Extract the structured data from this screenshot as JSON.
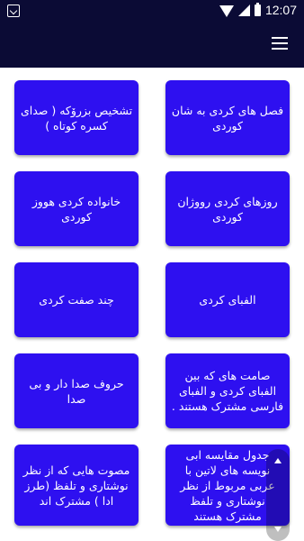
{
  "status_bar": {
    "time": "12:07",
    "icons": [
      "notification-icon",
      "wifi-icon",
      "signal-icon",
      "battery-icon"
    ]
  },
  "app_bar": {
    "menu_icon": "hamburger-menu-icon"
  },
  "colors": {
    "bar_background": "#0b0b35",
    "card_background": "#2e10f0",
    "card_text": "#ffffff"
  },
  "cards": [
    {
      "label": "فصل های کردی به شان کوردی"
    },
    {
      "label": "تشخیص بزرۆکه ( صدای کسره کوتاه )"
    },
    {
      "label": "روزهای کردی رووژان کوردی"
    },
    {
      "label": "خانواده کردی هووز کوردی"
    },
    {
      "label": "الفبای کردی"
    },
    {
      "label": "چند صفت کردی"
    },
    {
      "label": "صامت های که بین الفبای کردی و الفبای فارسی مشترک هستند ."
    },
    {
      "label": "حروف صدا دار و بی صدا"
    },
    {
      "label": "جدول مقایسه ابی نویسه های لاتین با عربی مربوط از نظر نوشتاری و تلفظ مشترک هستند"
    },
    {
      "label": "مصوت هایی که از نظر نوشتاری و تلفظ (طرز ادا ) مشترک اند"
    }
  ]
}
